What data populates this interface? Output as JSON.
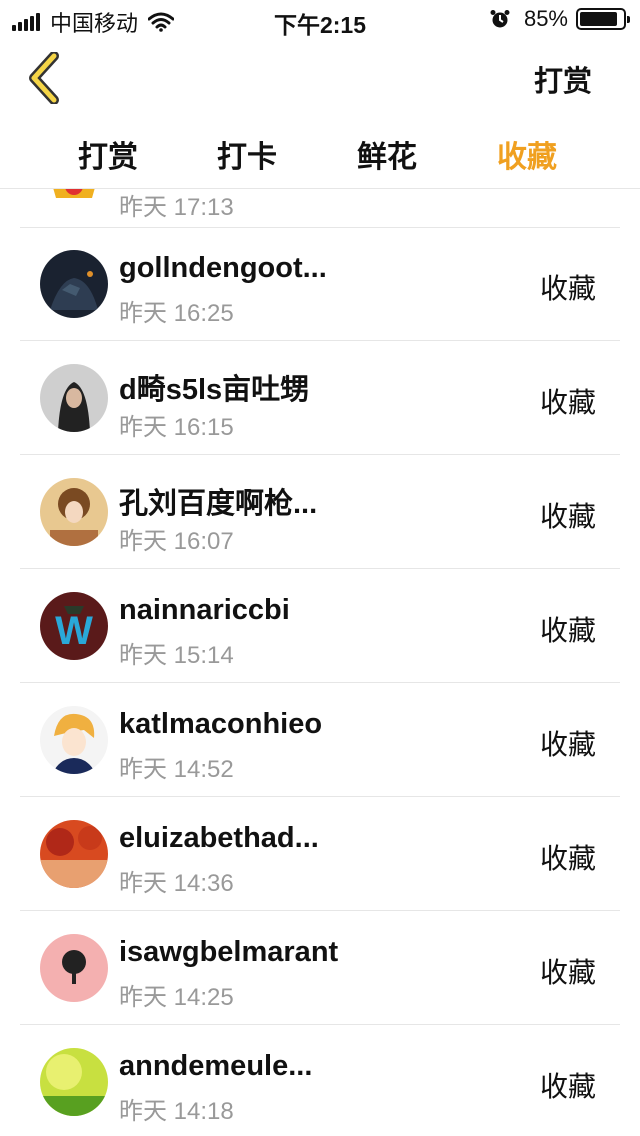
{
  "status_bar": {
    "carrier": "中国移动",
    "time": "下午2:15",
    "battery": "85%"
  },
  "nav": {
    "right_label": "打赏"
  },
  "tabs": [
    {
      "label": "打赏",
      "active": false
    },
    {
      "label": "打卡",
      "active": false
    },
    {
      "label": "鲜花",
      "active": false
    },
    {
      "label": "收藏",
      "active": true
    }
  ],
  "partial_row": {
    "time": "昨天 17:13"
  },
  "rows": [
    {
      "name": "gollndengoot...",
      "time": "昨天 16:25",
      "action": "收藏"
    },
    {
      "name": "d畸s5ls亩吐甥",
      "time": "昨天 16:15",
      "action": "收藏"
    },
    {
      "name": "孔刘百度啊枪...",
      "time": "昨天 16:07",
      "action": "收藏"
    },
    {
      "name": "nainnariccbi",
      "time": "昨天 15:14",
      "action": "收藏"
    },
    {
      "name": "katlmaconhieo",
      "time": "昨天 14:52",
      "action": "收藏"
    },
    {
      "name": "eluizabethad...",
      "time": "昨天 14:36",
      "action": "收藏"
    },
    {
      "name": "isawgbelmarant",
      "time": "昨天 14:25",
      "action": "收藏"
    },
    {
      "name": "anndemeule...",
      "time": "昨天 14:18",
      "action": "收藏"
    }
  ],
  "colors": {
    "accent": "#f0a020",
    "secondary_text": "#999999",
    "divider": "#e6e6e6"
  }
}
